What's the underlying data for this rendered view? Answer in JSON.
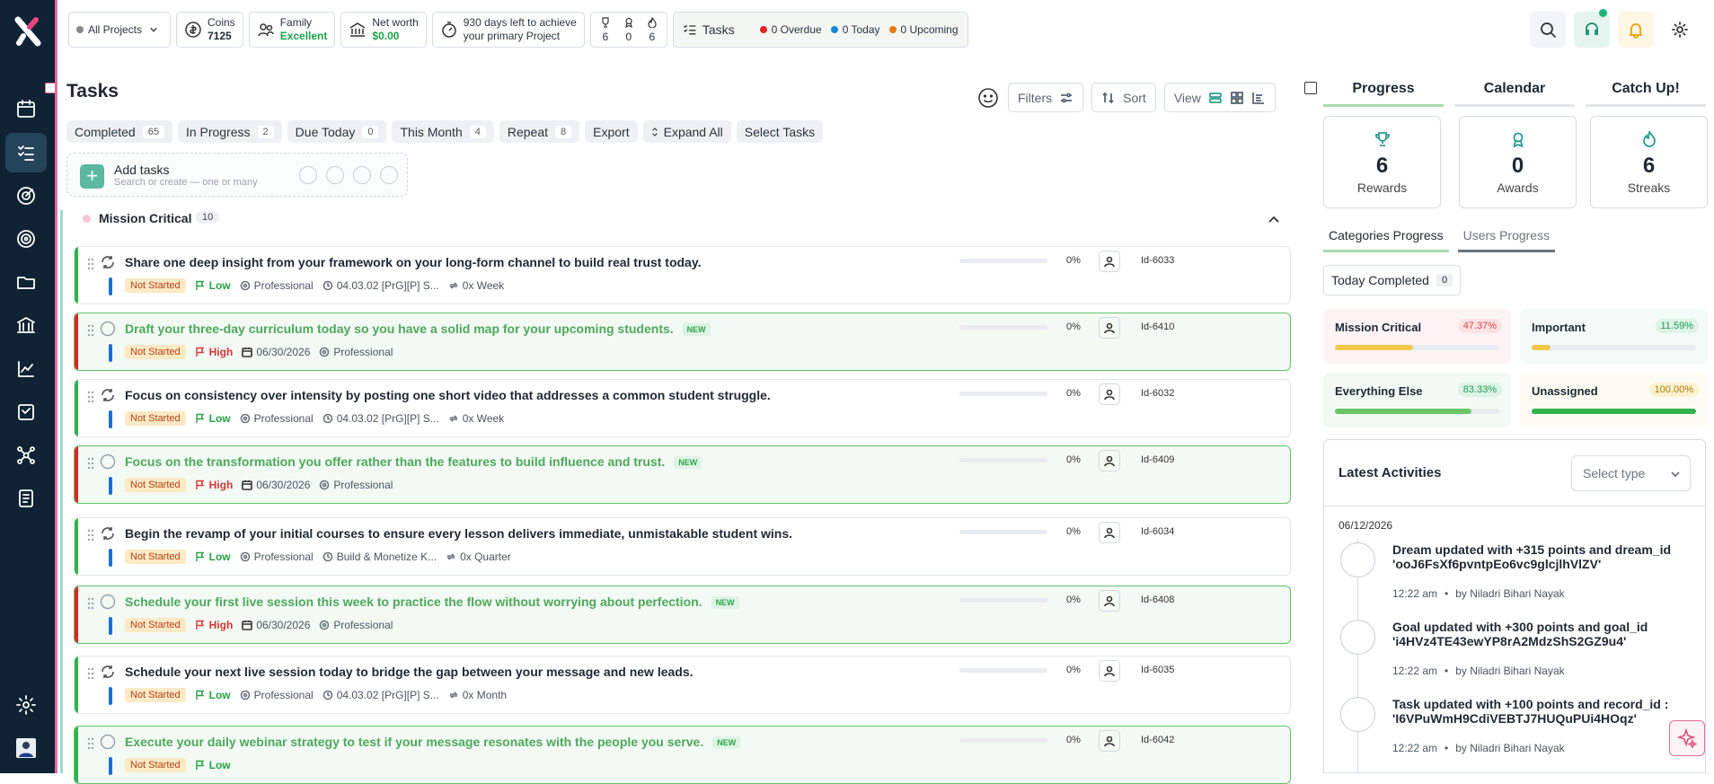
{
  "topbar": {
    "project_selector": "All Projects",
    "coins_label": "Coins",
    "coins_value": "7125",
    "family_label": "Family",
    "family_value": "Excellent",
    "networth_label": "Net worth",
    "networth_value": "$0.00",
    "countdown_line1": "930 days left to achieve",
    "countdown_line2": "your primary Project",
    "mini_stats": [
      "6",
      "0",
      "6"
    ],
    "tasks_label": "Tasks",
    "overdue": "0 Overdue",
    "today": "0 Today",
    "upcoming": "0 Upcoming"
  },
  "colors": {
    "overdue": "#e02424",
    "today": "#1c84d6",
    "upcoming": "#e8780c",
    "sidebar": "#0f2334",
    "accent_pink": "#e86d9a",
    "success": "#18a34a"
  },
  "sidebar": {
    "icons": [
      "calendar-icon",
      "tasks-icon",
      "goal-icon",
      "target-icon",
      "folder-icon",
      "bank-icon",
      "chart-icon",
      "document-icon",
      "network-icon",
      "report-icon",
      "settings-icon",
      "avatar"
    ]
  },
  "main": {
    "title": "Tasks",
    "filters_label": "Filters",
    "sort_label": "Sort",
    "view_label": "View",
    "chips": [
      {
        "label": "Completed",
        "count": "65"
      },
      {
        "label": "In Progress",
        "count": "2"
      },
      {
        "label": "Due Today",
        "count": "0"
      },
      {
        "label": "This Month",
        "count": "4"
      },
      {
        "label": "Repeat",
        "count": "8"
      },
      {
        "label": "Export",
        "count": null
      },
      {
        "label": "Expand All",
        "count": null
      },
      {
        "label": "Select Tasks",
        "count": null
      }
    ],
    "add_title": "Add tasks",
    "add_hint": "Search or create — one or many",
    "group_name": "Mission Critical",
    "group_count": "10"
  },
  "tasks": [
    {
      "title": "Share one deep insight from your framework on your long-form channel to build real trust today.",
      "new": false,
      "status": "Not Started",
      "priority": "Low",
      "date": "",
      "category": "Professional",
      "project": "04.03.02 [PrG][P] S...",
      "repeat": "0x Week",
      "percent": "0%",
      "id": "Id-6033"
    },
    {
      "title": "Draft your three-day curriculum today so you have a solid map for your upcoming students.",
      "new": true,
      "status": "Not Started",
      "priority": "High",
      "date": "06/30/2026",
      "category": "Professional",
      "project": "",
      "repeat": "",
      "percent": "0%",
      "id": "Id-6410"
    },
    {
      "title": "Focus on consistency over intensity by posting one short video that addresses a common student struggle.",
      "new": false,
      "status": "Not Started",
      "priority": "Low",
      "date": "",
      "category": "Professional",
      "project": "04.03.02 [PrG][P] S...",
      "repeat": "0x Week",
      "percent": "0%",
      "id": "Id-6032"
    },
    {
      "title": "Focus on the transformation you offer rather than the features to build influence and trust.",
      "new": true,
      "status": "Not Started",
      "priority": "High",
      "date": "06/30/2026",
      "category": "Professional",
      "project": "",
      "repeat": "",
      "percent": "0%",
      "id": "Id-6409"
    },
    {
      "title": "Begin the revamp of your initial courses to ensure every lesson delivers immediate, unmistakable student wins.",
      "new": false,
      "status": "Not Started",
      "priority": "Low",
      "date": "",
      "category": "Professional",
      "project": "Build & Monetize K...",
      "repeat": "0x Quarter",
      "percent": "0%",
      "id": "Id-6034"
    },
    {
      "title": "Schedule your first live session this week to practice the flow without worrying about perfection.",
      "new": true,
      "status": "Not Started",
      "priority": "High",
      "date": "06/30/2026",
      "category": "Professional",
      "project": "",
      "repeat": "",
      "percent": "0%",
      "id": "Id-6408"
    },
    {
      "title": "Schedule your next live session today to bridge the gap between your message and new leads.",
      "new": false,
      "status": "Not Started",
      "priority": "Low",
      "date": "",
      "category": "Professional",
      "project": "04.03.02 [PrG][P] S...",
      "repeat": "0x Month",
      "percent": "0%",
      "id": "Id-6035"
    },
    {
      "title": "Execute your daily webinar strategy to test if your message resonates with the people you serve.",
      "new": true,
      "status": "Not Started",
      "priority": "Low",
      "date": "",
      "category": "",
      "project": "",
      "repeat": "",
      "percent": "0%",
      "id": "Id-6042"
    }
  ],
  "new_badge": "NEW",
  "right": {
    "tabs": [
      "Progress",
      "Calendar",
      "Catch Up!"
    ],
    "stats": [
      {
        "value": "6",
        "label": "Rewards"
      },
      {
        "value": "0",
        "label": "Awards"
      },
      {
        "value": "6",
        "label": "Streaks"
      }
    ],
    "cat_tabs": [
      "Categories Progress",
      "Users Progress"
    ],
    "today_completed_label": "Today Completed",
    "today_completed_count": "0",
    "categories": [
      {
        "name": "Mission Critical",
        "percent": "47.37%",
        "fraction": 0.4737,
        "bar": "#f2c94c",
        "bg": "#fdf3f5",
        "pbg": "#fde2e4",
        "pfg": "#d64545"
      },
      {
        "name": "Important",
        "percent": "11.59%",
        "fraction": 0.1159,
        "bar": "#f2c94c",
        "bg": "#f3faf7",
        "pbg": "#ddf3e6",
        "pfg": "#1e9b57"
      },
      {
        "name": "Everything Else",
        "percent": "83.33%",
        "fraction": 0.8333,
        "bar": "#6cc565",
        "bg": "#f3faf3",
        "pbg": "#ddf3e6",
        "pfg": "#1e9b57"
      },
      {
        "name": "Unassigned",
        "percent": "100.00%",
        "fraction": 1.0,
        "bar": "#33b249",
        "bg": "#fcfcf4",
        "pbg": "#fdf2cf",
        "pfg": "#a97a06"
      }
    ],
    "activities_title": "Latest Activities",
    "select_type": "Select type",
    "activity_date": "06/12/2026",
    "activities": [
      {
        "text": "Dream updated with +315 points and dream_id 'ooJ6FsXf6pvntpEo6vc9glcjlhVlZV'",
        "time": "12:22 am",
        "by": "by Niladri Bihari Nayak"
      },
      {
        "text": "Goal updated with +300 points and goal_id 'i4HVz4TE43ewYP8rA2MdzShS2GZ9u4'",
        "time": "12:22 am",
        "by": "by Niladri Bihari Nayak"
      },
      {
        "text": "Task updated with +100 points and record_id : 'I6VPuWmH9CdiVEBTJ7HUQuPUi4HOqz'",
        "time": "12:22 am",
        "by": "by Niladri Bihari Nayak"
      }
    ]
  }
}
